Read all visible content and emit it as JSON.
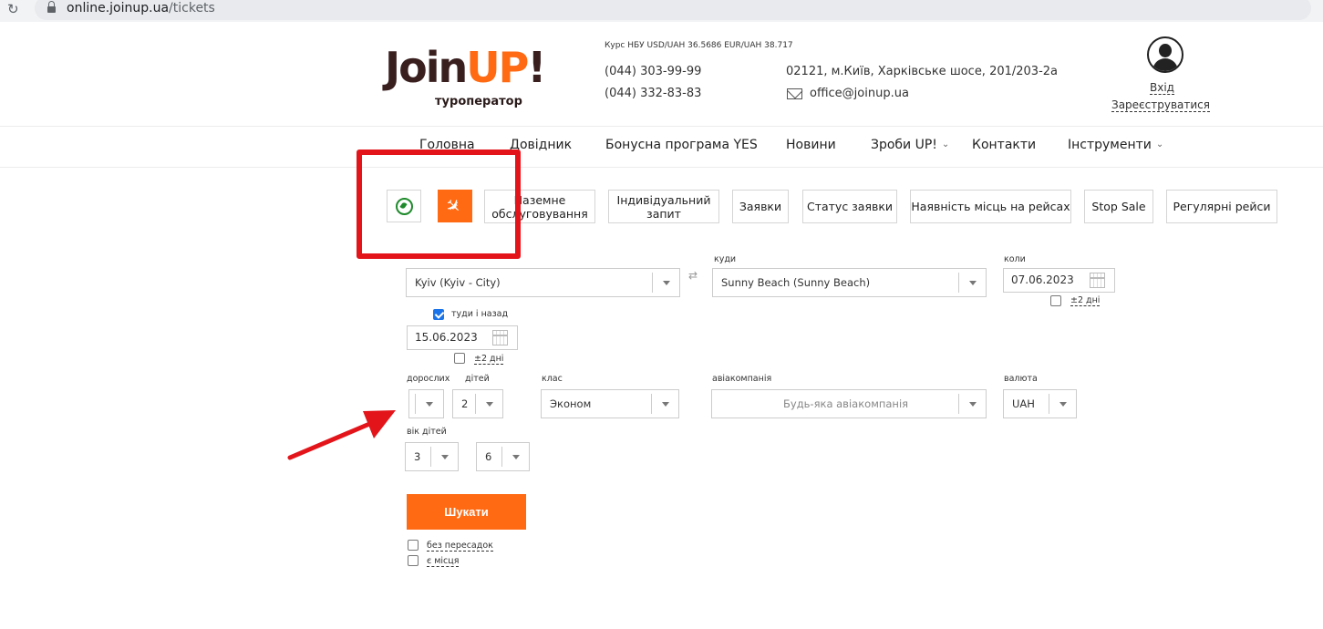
{
  "browser": {
    "url_host": "online.joinup.ua",
    "url_path": "/tickets"
  },
  "header": {
    "logo_main_join": "Join",
    "logo_main_up": "UP",
    "logo_main_excl": "!",
    "logo_sub": "туроператор",
    "rates": "Курс НБУ USD/UAH 36.5686   EUR/UAH 38.717",
    "phone1": "(044) 303-99-99",
    "phone2": "(044) 332-83-83",
    "address": "02121, м.Київ, Харківське шосе, 201/203-2а",
    "email": "office@joinup.ua",
    "login": "Вхід",
    "register": "Зареєструватися"
  },
  "nav": {
    "items": [
      {
        "label": "Головна"
      },
      {
        "label": "Довідник"
      },
      {
        "label": "Бонусна програма YES"
      },
      {
        "label": "Новини"
      },
      {
        "label": "Зроби UP!",
        "has_dropdown": true
      },
      {
        "label": "Контакти"
      },
      {
        "label": "Інструменти",
        "has_dropdown": true
      }
    ]
  },
  "tabs": {
    "icon_tabs": [
      {
        "icon": "compass-icon",
        "active": false
      },
      {
        "icon": "airplane-icon",
        "active": true
      }
    ],
    "buttons": [
      {
        "label": "Наземне обслуговування"
      },
      {
        "label": "Індивідуальний запит"
      },
      {
        "label": "Заявки"
      },
      {
        "label": "Статус заявки"
      },
      {
        "label": "Наявність місць на рейсах"
      },
      {
        "label": "Stop Sale"
      },
      {
        "label": "Регулярні рейси"
      }
    ]
  },
  "form": {
    "to_label": "куди",
    "when_label": "коли",
    "from_value": "Kyiv (Kyiv - City)",
    "to_value": "Sunny Beach (Sunny Beach)",
    "depart_date": "07.06.2023",
    "depart_flex_label": "±2 дні",
    "round_trip_label": "туди і назад",
    "return_date": "15.06.2023",
    "return_flex_label": "±2 дні",
    "adults_label": "дорослих",
    "adults_value": "",
    "children_label": "дітей",
    "children_value": "2",
    "class_label": "клас",
    "class_value": "Эконом",
    "airline_label": "авіакомпанія",
    "airline_placeholder": "Будь-яка авіакомпанія",
    "currency_label": "валюта",
    "currency_value": "UAH",
    "child_ages_label": "вік дітей",
    "child_age_1": "3",
    "child_age_2": "6",
    "search_label": "Шукати",
    "nonstop_label": "без пересадок",
    "available_label": "є місця"
  },
  "colors": {
    "brand_orange": "#ff6a13",
    "annotation_red": "#e3151b",
    "compass_green": "#1f8a2c"
  }
}
